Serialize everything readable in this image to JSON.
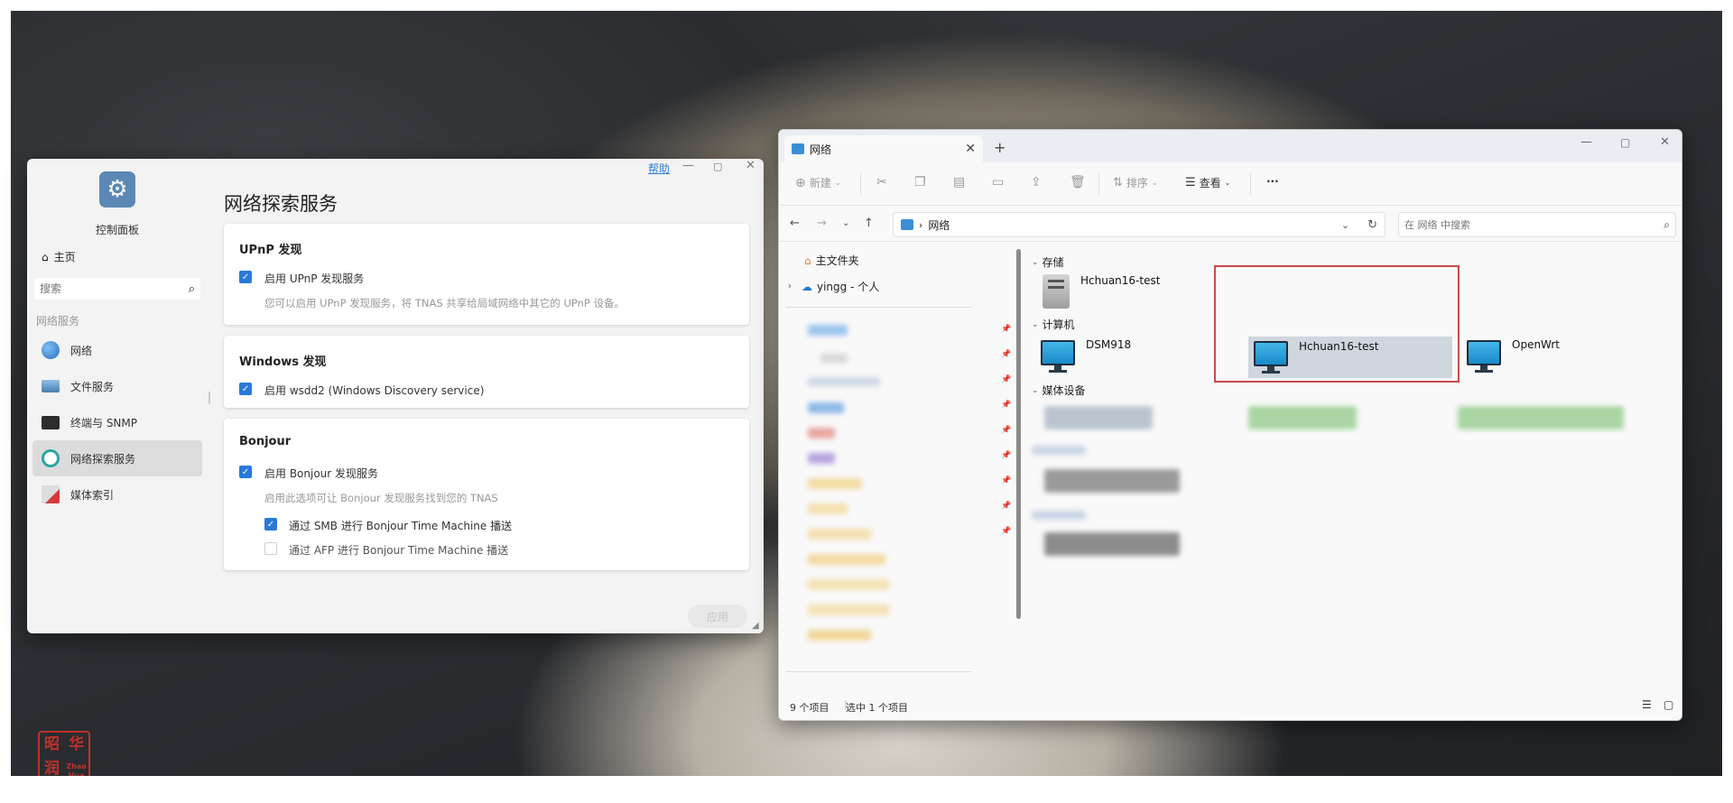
{
  "watermark": {
    "chars": [
      "昭",
      "华",
      "润",
      "Z"
    ]
  },
  "control_panel": {
    "app_label": "控制面板",
    "home": "主页",
    "search_placeholder": "搜索",
    "section": "网络服务",
    "help": "帮助",
    "nav": [
      {
        "label": "网络",
        "icon": "globe-icon",
        "color": "#3d8be0"
      },
      {
        "label": "文件服务",
        "icon": "file-server-icon",
        "color": "#5b9bd5"
      },
      {
        "label": "终端与 SNMP",
        "icon": "terminal-icon",
        "color": "#333333"
      },
      {
        "label": "网络探索服务",
        "icon": "magnifier-icon",
        "color": "#2aa7a0",
        "active": true
      },
      {
        "label": "媒体索引",
        "icon": "media-index-icon",
        "color": "#d33b3b"
      }
    ],
    "title": "网络探索服务",
    "upnp": {
      "heading": "UPnP 发现",
      "option": "启用 UPnP 发现服务",
      "hint": "您可以启用 UPnP 发现服务，将 TNAS 共享给局域网络中其它的 UPnP 设备。"
    },
    "windows": {
      "heading": "Windows 发现",
      "option": "启用 wsdd2 (Windows Discovery service)"
    },
    "bonjour": {
      "heading": "Bonjour",
      "option": "启用 Bonjour 发现服务",
      "hint": "启用此选项可让 Bonjour 发现服务找到您的 TNAS",
      "smb": "通过 SMB 进行 Bonjour Time Machine 播送",
      "afp": "通过 AFP 进行 Bonjour Time Machine 播送"
    },
    "apply": "应用"
  },
  "explorer": {
    "tab_title": "网络",
    "toolbar": {
      "new": "新建",
      "sort": "排序",
      "view": "查看",
      "more": "···"
    },
    "address": "网络",
    "search_placeholder": "在 网络 中搜索",
    "tree": {
      "home": "主文件夹",
      "onedrive": "yingg - 个人"
    },
    "groups": {
      "storage": "存储",
      "computers": "计算机",
      "media": "媒体设备"
    },
    "storage_items": [
      "Hchuan16-test"
    ],
    "computer_items": [
      "DSM918",
      "Hchuan16-test",
      "OpenWrt"
    ],
    "status": {
      "count": "9 个项目",
      "selected": "选中 1 个项目"
    }
  }
}
